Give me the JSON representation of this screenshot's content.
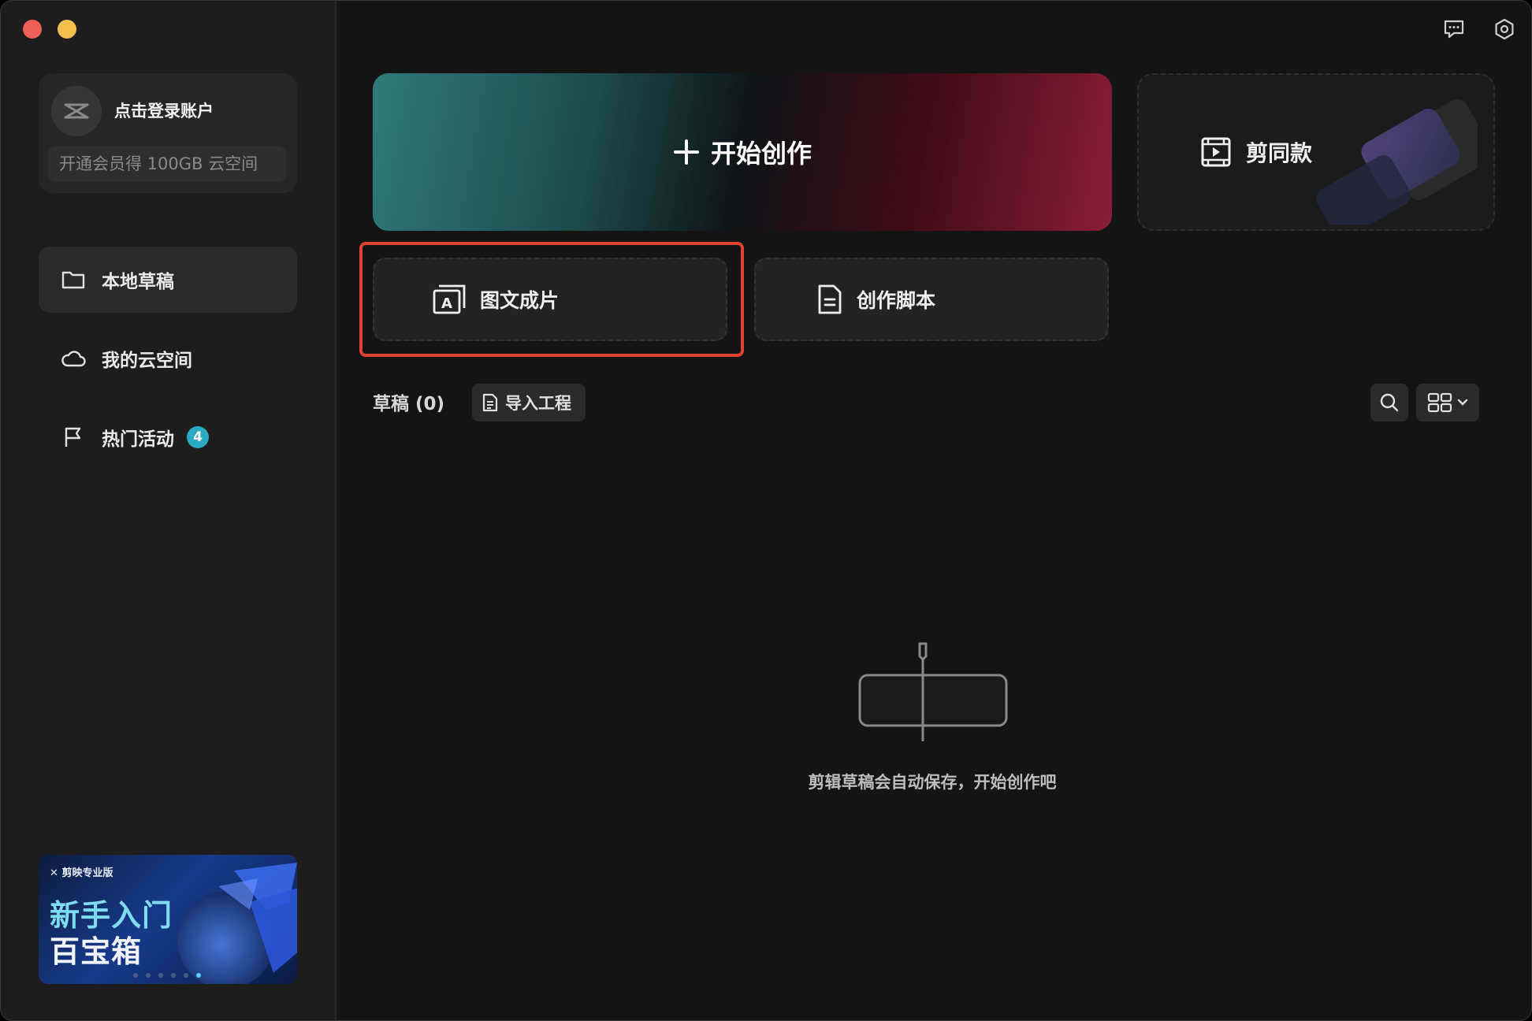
{
  "sidebar": {
    "account": {
      "login_label": "点击登录账户",
      "vip_promo": "开通会员得 100GB 云空间"
    },
    "nav": [
      {
        "label": "本地草稿",
        "icon": "folder-icon",
        "active": true
      },
      {
        "label": "我的云空间",
        "icon": "cloud-icon",
        "active": false
      },
      {
        "label": "热门活动",
        "icon": "flag-icon",
        "active": false,
        "badge": "4"
      }
    ],
    "banner": {
      "logo": "剪映专业版",
      "title_line1": "新手入门",
      "title_line2": "百宝箱"
    }
  },
  "main": {
    "start_create": "开始创作",
    "cut_same": "剪同款",
    "image_text_video": "图文成片",
    "create_script": "创作脚本",
    "drafts_title": "草稿 (0)",
    "import_project": "导入工程",
    "empty_message": "剪辑草稿会自动保存，开始创作吧"
  },
  "colors": {
    "highlight_border": "#e0442e",
    "badge": "#2aa9c2"
  }
}
